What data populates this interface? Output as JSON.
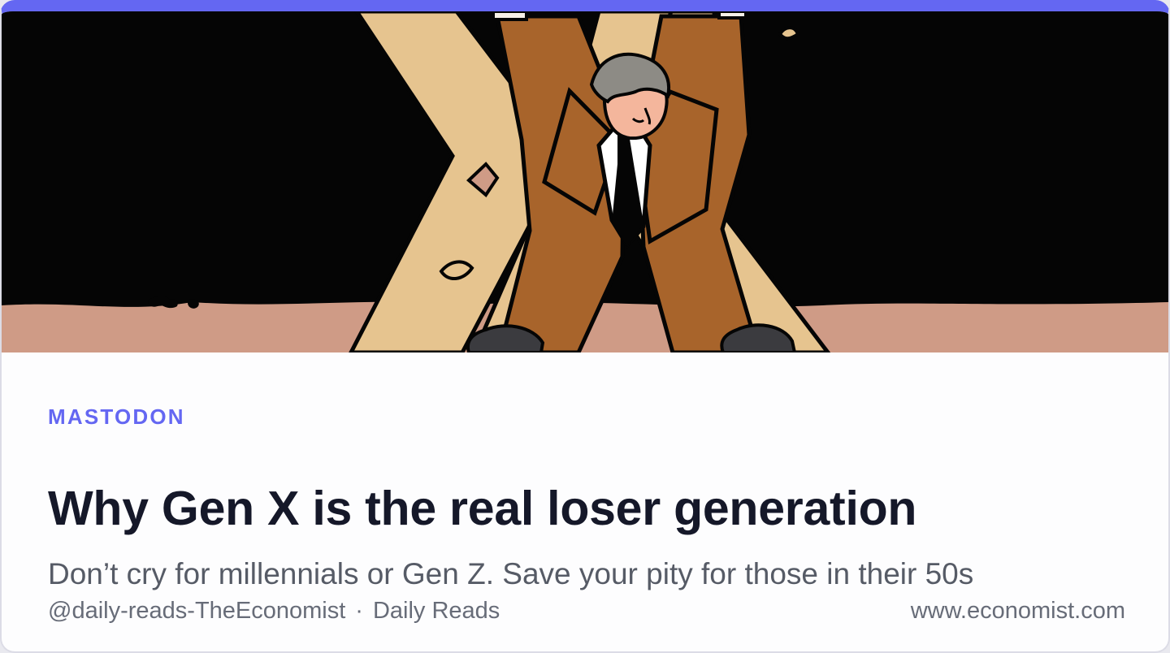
{
  "card": {
    "source_label": "MASTODON",
    "title": "Why Gen X is the real loser generation",
    "description": "Don’t cry for millennials or Gen Z. Save your pity for those in their 50s",
    "account": "@daily-reads-TheEconomist",
    "separator": "·",
    "publication": "Daily Reads",
    "domain": "www.economist.com"
  },
  "image": {
    "description_name": "gen-x-illustration"
  },
  "colors": {
    "accent": "#6467f2",
    "title": "#151829",
    "body_text": "#565b66",
    "meta_text": "#676c78",
    "background": "#fdfdfe"
  }
}
